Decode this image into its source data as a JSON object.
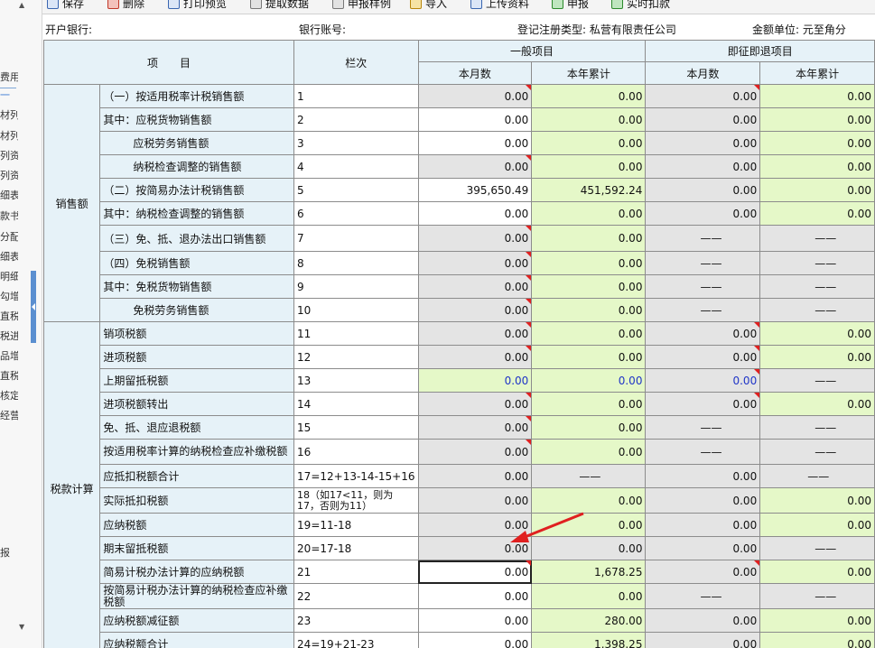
{
  "toolbar": {
    "save": "保存",
    "delete": "删除",
    "print_preview": "打印预览",
    "fetch_data": "提取数据",
    "report_sample": "申报样例",
    "import": "导入",
    "upload": "上传资料",
    "declare": "申报",
    "realtime_deduct": "实时扣款"
  },
  "left_panel": {
    "items": [
      "费用",
      "一",
      "材列",
      "材列",
      "列资",
      "列资",
      "细表",
      "款书",
      "分配",
      "细表",
      "明细",
      "勾增",
      "直税",
      "税进",
      "品增",
      "直税",
      "核定",
      "经营",
      "报"
    ]
  },
  "info": {
    "bank_label": "开户银行:",
    "account_label": "银行账号:",
    "reg_type": "登记注册类型: 私营有限责任公司",
    "unit": "金额单位: 元至角分"
  },
  "header": {
    "item": "项　　目",
    "column": "栏次",
    "general": "一般项目",
    "immediate": "即征即退项目",
    "month": "本月数",
    "year": "本年累计"
  },
  "categories": {
    "sales": "销售额",
    "tax": "税款计算"
  },
  "rows": [
    {
      "label": "（一）按适用税率计税销售额",
      "col": "1",
      "gm": "0.00",
      "gy": "0.00",
      "im": "0.00",
      "iy": "0.00"
    },
    {
      "label": "其中：应税货物销售额",
      "col": "2",
      "gm": "0.00",
      "gy": "0.00",
      "im": "0.00",
      "iy": "0.00"
    },
    {
      "label": "应税劳务销售额",
      "col": "3",
      "gm": "0.00",
      "gy": "0.00",
      "im": "0.00",
      "iy": "0.00"
    },
    {
      "label": "纳税检查调整的销售额",
      "col": "4",
      "gm": "0.00",
      "gy": "0.00",
      "im": "0.00",
      "iy": "0.00"
    },
    {
      "label": "（二）按简易办法计税销售额",
      "col": "5",
      "gm": "395,650.49",
      "gy": "451,592.24",
      "im": "0.00",
      "iy": "0.00"
    },
    {
      "label": "其中：纳税检查调整的销售额",
      "col": "6",
      "gm": "0.00",
      "gy": "0.00",
      "im": "0.00",
      "iy": "0.00"
    },
    {
      "label": "（三）免、抵、退办法出口销售额",
      "col": "7",
      "gm": "0.00",
      "gy": "0.00",
      "im": "——",
      "iy": "——"
    },
    {
      "label": "（四）免税销售额",
      "col": "8",
      "gm": "0.00",
      "gy": "0.00",
      "im": "——",
      "iy": "——"
    },
    {
      "label": "其中：免税货物销售额",
      "col": "9",
      "gm": "0.00",
      "gy": "0.00",
      "im": "——",
      "iy": "——"
    },
    {
      "label": "免税劳务销售额",
      "col": "10",
      "gm": "0.00",
      "gy": "0.00",
      "im": "——",
      "iy": "——"
    },
    {
      "label": "销项税额",
      "col": "11",
      "gm": "0.00",
      "gy": "0.00",
      "im": "0.00",
      "iy": "0.00"
    },
    {
      "label": "进项税额",
      "col": "12",
      "gm": "0.00",
      "gy": "0.00",
      "im": "0.00",
      "iy": "0.00"
    },
    {
      "label": "上期留抵税额",
      "col": "13",
      "gm": "0.00",
      "gy": "0.00",
      "im": "0.00",
      "iy": "——"
    },
    {
      "label": "进项税额转出",
      "col": "14",
      "gm": "0.00",
      "gy": "0.00",
      "im": "0.00",
      "iy": "0.00"
    },
    {
      "label": "免、抵、退应退税额",
      "col": "15",
      "gm": "0.00",
      "gy": "0.00",
      "im": "——",
      "iy": "——"
    },
    {
      "label": "按适用税率计算的纳税检查应补缴税额",
      "col": "16",
      "gm": "0.00",
      "gy": "0.00",
      "im": "——",
      "iy": "——"
    },
    {
      "label": "应抵扣税额合计",
      "col": "17=12+13-14-15+16",
      "gm": "0.00",
      "gy": "——",
      "im": "0.00",
      "iy": "——"
    },
    {
      "label": "实际抵扣税额",
      "col": "18（如17<11，则为17，否则为11）",
      "gm": "0.00",
      "gy": "0.00",
      "im": "0.00",
      "iy": "0.00"
    },
    {
      "label": "应纳税额",
      "col": "19=11-18",
      "gm": "0.00",
      "gy": "0.00",
      "im": "0.00",
      "iy": "0.00"
    },
    {
      "label": "期末留抵税额",
      "col": "20=17-18",
      "gm": "0.00",
      "gy": "0.00",
      "im": "0.00",
      "iy": "——"
    },
    {
      "label": "简易计税办法计算的应纳税额",
      "col": "21",
      "gm": "0.00",
      "gy": "1,678.25",
      "im": "0.00",
      "iy": "0.00"
    },
    {
      "label": "按简易计税办法计算的纳税检查应补缴税额",
      "col": "22",
      "gm": "0.00",
      "gy": "0.00",
      "im": "——",
      "iy": "——"
    },
    {
      "label": "应纳税额减征额",
      "col": "23",
      "gm": "0.00",
      "gy": "280.00",
      "im": "0.00",
      "iy": "0.00"
    },
    {
      "label": "应纳税额合计",
      "col": "24=19+21-23",
      "gm": "0.00",
      "gy": "1,398.25",
      "im": "0.00",
      "iy": "0.00"
    }
  ],
  "colors": {
    "header_bg": "#e6f2f8",
    "readonly_gray": "#e4e4e4",
    "editable_green": "#e5f8c8",
    "annotation_red": "#e02020"
  }
}
